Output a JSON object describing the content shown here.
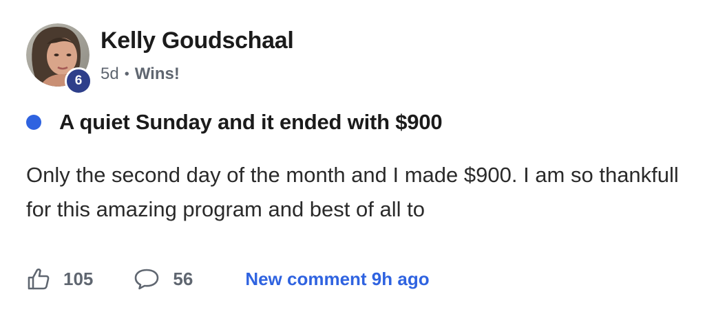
{
  "post": {
    "author": {
      "name": "Kelly Goudschaal",
      "level": "6",
      "avatar_icon": "user-photo-avatar"
    },
    "meta": {
      "time": "5d",
      "separator": "•",
      "category": "Wins!"
    },
    "unread_dot_color": "#2f63e0",
    "title": "A quiet Sunday and it ended with $900",
    "body": "Only the second day of the month and I made $900. I am so thankfull for this amazing program and best of all to",
    "footer": {
      "like_icon": "thumbs-up-icon",
      "like_count": "105",
      "comment_icon": "comment-bubble-icon",
      "comment_count": "56",
      "new_comment_text": "New comment 9h ago"
    }
  },
  "colors": {
    "accent": "#2f63e0",
    "badge": "#2e3f8a",
    "muted": "#5f6670"
  }
}
